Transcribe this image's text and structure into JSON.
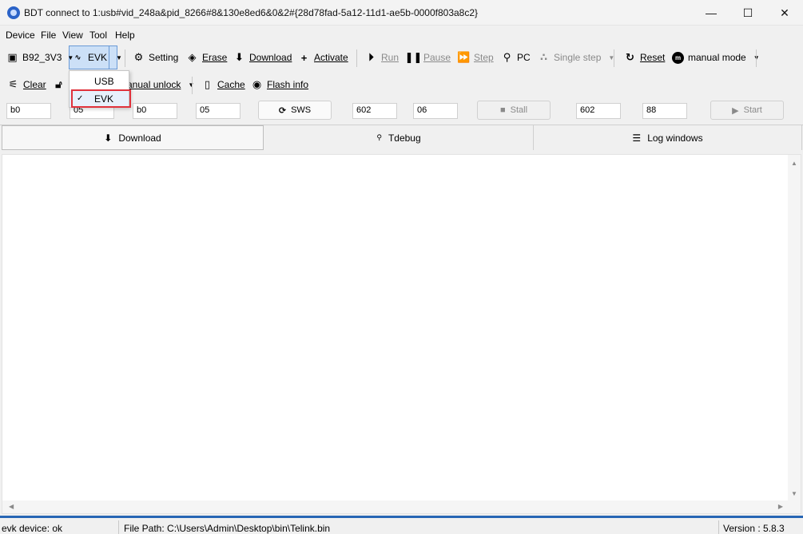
{
  "window": {
    "title": "BDT connect to 1:usb#vid_248a&pid_8266#8&130e8ed6&0&2#{28d78fad-5a12-11d1-ae5b-0000f803a8c2}",
    "minimize_glyph": "—",
    "maximize_glyph": "☐",
    "close_glyph": "✕"
  },
  "menu": {
    "items": [
      "Device",
      "File",
      "View",
      "Tool",
      "Help"
    ]
  },
  "toolbar1": {
    "chip": "B92_3V3",
    "interface": "EVK",
    "setting": "Setting",
    "erase": "Erase",
    "download": "Download",
    "activate": "Activate",
    "run": "Run",
    "pause": "Pause",
    "step": "Step",
    "pc": "PC",
    "single_step": "Single step",
    "reset": "Reset",
    "mode": "manual mode"
  },
  "toolbar2": {
    "clear": "Clear",
    "unlock": "anual unlock",
    "cache": "Cache",
    "flash_info": "Flash info"
  },
  "interface_dropdown": {
    "options": [
      "USB",
      "EVK"
    ],
    "selected": "EVK",
    "check_glyph": "✓"
  },
  "params": {
    "fields": [
      "b0",
      "05",
      "b0",
      "05",
      "602",
      "06",
      "602",
      "88"
    ],
    "sws_label": "SWS",
    "stall_label": "Stall",
    "start_label": "Start"
  },
  "tabs": [
    "Download",
    "Tdebug",
    "Log windows"
  ],
  "status": {
    "device": "evk device: ok",
    "file_path": "File Path:  C:\\Users\\Admin\\Desktop\\bin\\Telink.bin",
    "version": "Version : 5.8.3"
  },
  "colors": {
    "accent": "#2866b4",
    "highlight_border": "#e0323c",
    "selected_button": "#cce0f7"
  },
  "icons": {
    "app": "app-icon",
    "chip": "chip-icon",
    "evk": "signal-icon",
    "setting": "gear-icon",
    "erase": "eraser-icon",
    "download": "download-arrow-icon",
    "activate": "plus-icon",
    "run": "play-icon",
    "pause": "pause-icon",
    "step": "step-icon",
    "pc": "search-icon",
    "single_step": "footprints-icon",
    "reset": "reset-icon",
    "mode": "mode-icon",
    "clear": "broom-icon",
    "unlock": "lock-icon",
    "cache": "sd-card-icon",
    "flash_info": "eye-icon"
  }
}
